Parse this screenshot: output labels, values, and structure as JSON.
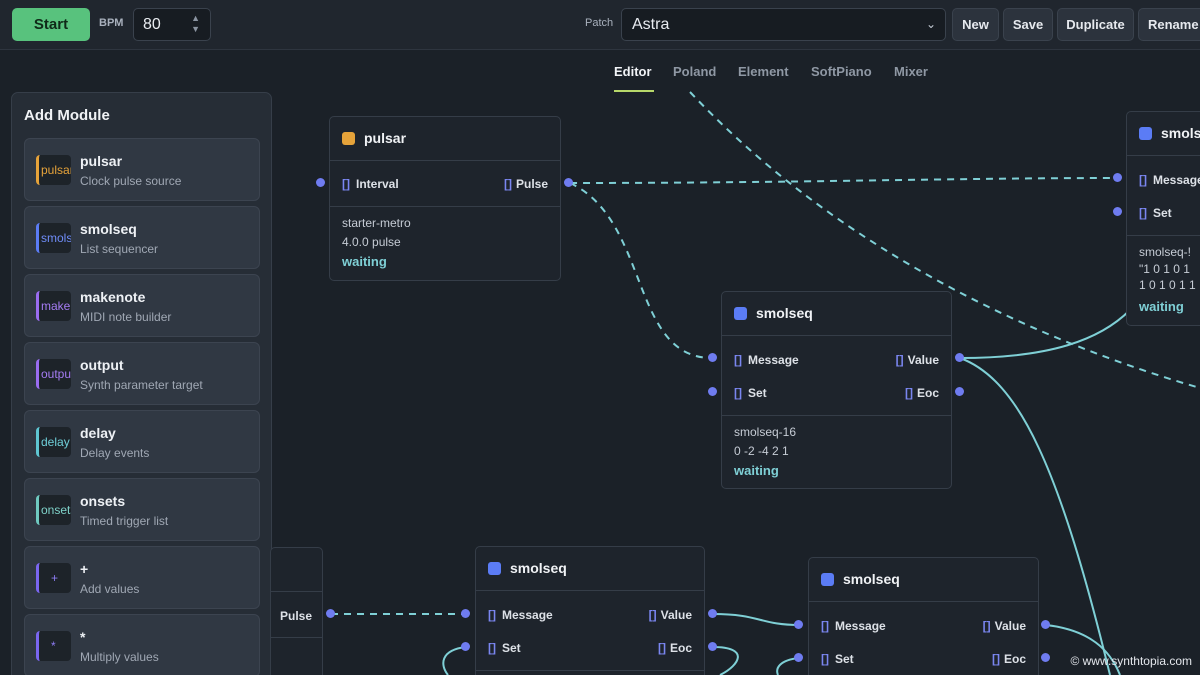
{
  "toolbar": {
    "start_label": "Start",
    "bpm_label": "BPM",
    "bpm_value": "80",
    "patch_label": "Patch",
    "patch_value": "Astra",
    "new_label": "New",
    "save_label": "Save",
    "duplicate_label": "Duplicate",
    "rename_label": "Rename"
  },
  "tabs": [
    "Editor",
    "Poland",
    "Element",
    "SoftPiano",
    "Mixer"
  ],
  "sidebar": {
    "title": "Add Module",
    "modules": [
      {
        "badge": "pulsar",
        "name": "pulsar",
        "desc": "Clock pulse source",
        "color": "#e6a33a"
      },
      {
        "badge": "smolseq",
        "name": "smolseq",
        "desc": "List sequencer",
        "color": "#5b7cf5"
      },
      {
        "badge": "makenote",
        "name": "makenote",
        "desc": "MIDI note builder",
        "color": "#9a6cf0"
      },
      {
        "badge": "output",
        "name": "output",
        "desc": "Synth parameter target",
        "color": "#9a6cf0"
      },
      {
        "badge": "delay",
        "name": "delay",
        "desc": "Delay events",
        "color": "#5fc6d2"
      },
      {
        "badge": "onsets",
        "name": "onsets",
        "desc": "Timed trigger list",
        "color": "#6fc9c0"
      },
      {
        "badge": "+",
        "name": "+",
        "desc": "Add values",
        "color": "#7a66f0"
      },
      {
        "badge": "*",
        "name": "*",
        "desc": "Multiply values",
        "color": "#7a66f0"
      }
    ]
  },
  "nodes": {
    "pulsar": {
      "title": "pulsar",
      "in": "Interval",
      "out": "Pulse",
      "info1": "starter-metro",
      "info2": "4.0.0 pulse",
      "status": "waiting"
    },
    "smolseq16": {
      "title": "smolseq",
      "in1": "Message",
      "in2": "Set",
      "out1": "Value",
      "out2": "Eoc",
      "info1": "smolseq-16",
      "info2": "0 -2 -4 2 1",
      "status": "waiting"
    },
    "smolseq_right": {
      "title": "smols",
      "in1": "Message",
      "in2": "Set",
      "info1": "smolseq-!",
      "info2": "\"1 0 1 0 1",
      "info3": "1 0 1 0 1 1",
      "status": "waiting"
    },
    "smolseq_bottom1": {
      "title": "smolseq",
      "in1": "Message",
      "in2": "Set",
      "out1": "Value",
      "out2": "Eoc"
    },
    "smolseq_bottom2": {
      "title": "smolseq",
      "in1": "Message",
      "in2": "Set",
      "out1": "Value",
      "out2": "Eoc"
    },
    "partial_left": {
      "out": "Pulse"
    }
  },
  "colors": {
    "accent_green": "#58c27d",
    "wire": "#7fd0d6",
    "port": "#6f7cf0",
    "pulsar": "#e6a33a",
    "smolseq": "#5b7cf5"
  },
  "watermark": "© www.synthtopia.com"
}
